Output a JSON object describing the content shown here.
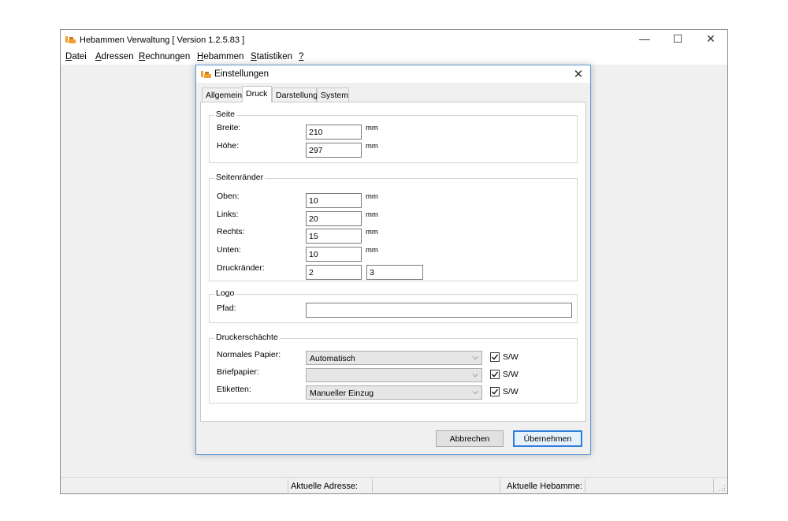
{
  "window": {
    "title": "Hebammen Verwaltung [ Version 1.2.5.83 ]",
    "minimize": "—",
    "maximize": "☐",
    "close": "✕"
  },
  "menu": [
    {
      "ul": "D",
      "rest": "atei"
    },
    {
      "ul": "A",
      "rest": "dressen"
    },
    {
      "ul": "R",
      "rest": "echnungen"
    },
    {
      "ul": "H",
      "rest": "ebammen"
    },
    {
      "ul": "S",
      "rest": "tatistiken"
    },
    {
      "ul": "?",
      "rest": ""
    }
  ],
  "dialog": {
    "title": "Einstellungen",
    "close": "✕",
    "tabs": [
      "Allgemein",
      "Druck",
      "Darstellung",
      "System"
    ],
    "active_tab": "Druck",
    "seite": {
      "title": "Seite",
      "breite_label": "Breite:",
      "breite_value": "210",
      "hoehe_label": "Höhe:",
      "hoehe_value": "297",
      "unit": "mm"
    },
    "raender": {
      "title": "Seitenränder",
      "oben_label": "Oben:",
      "oben_value": "10",
      "links_label": "Links:",
      "links_value": "20",
      "rechts_label": "Rechts:",
      "rechts_value": "15",
      "unten_label": "Unten:",
      "unten_value": "10",
      "druck_label": "Druckränder:",
      "druck_value1": "2",
      "druck_value2": "3",
      "unit": "mm"
    },
    "logo": {
      "title": "Logo",
      "pfad_label": "Pfad:",
      "pfad_value": ""
    },
    "schaechte": {
      "title": "Druckerschächte",
      "normal_label": "Normales Papier:",
      "normal_value": "Automatisch",
      "brief_label": "Briefpapier:",
      "brief_value": "",
      "etiketten_label": "Etiketten:",
      "etiketten_value": "Manueller Einzug",
      "sw_label": "S/W",
      "sw_checked": true
    },
    "cancel_button": "Abbrechen",
    "ok_button": "Übernehmen"
  },
  "statusbar": {
    "address_label": "Aktuelle Adresse:",
    "midwife_label": "Aktuelle Hebamme:"
  }
}
